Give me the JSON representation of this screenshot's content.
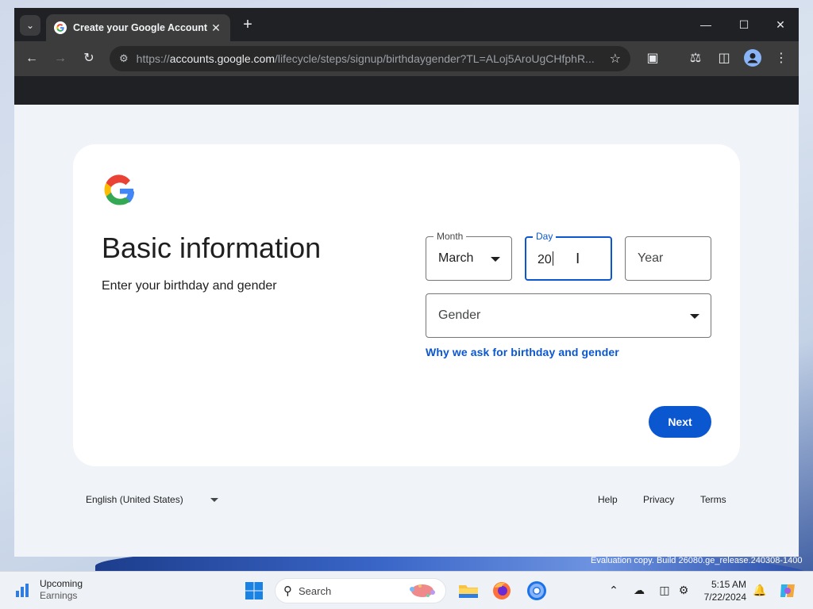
{
  "browser": {
    "tab_title": "Create your Google Account",
    "url_prefix": "https://",
    "url_host": "accounts.google.com",
    "url_path": "/lifecycle/steps/signup/birthdaygender?TL=ALoj5AroUgCHfphR..."
  },
  "page": {
    "heading": "Basic information",
    "subheading": "Enter your birthday and gender",
    "month_label": "Month",
    "month_value": "March",
    "day_label": "Day",
    "day_value": "20",
    "year_placeholder": "Year",
    "gender_placeholder": "Gender",
    "why_link": "Why we ask for birthday and gender",
    "next_label": "Next"
  },
  "footer": {
    "language": "English (United States)",
    "help": "Help",
    "privacy": "Privacy",
    "terms": "Terms"
  },
  "watermark": "Evaluation copy. Build 26080.ge_release.240308-1400",
  "taskbar": {
    "weather_title": "Upcoming",
    "weather_sub": "Earnings",
    "search_placeholder": "Search",
    "time": "5:15 AM",
    "date": "7/22/2024"
  },
  "colors": {
    "accent": "#0b57d0",
    "chrome_dark": "#202124",
    "page_bg": "#f0f4f9"
  }
}
